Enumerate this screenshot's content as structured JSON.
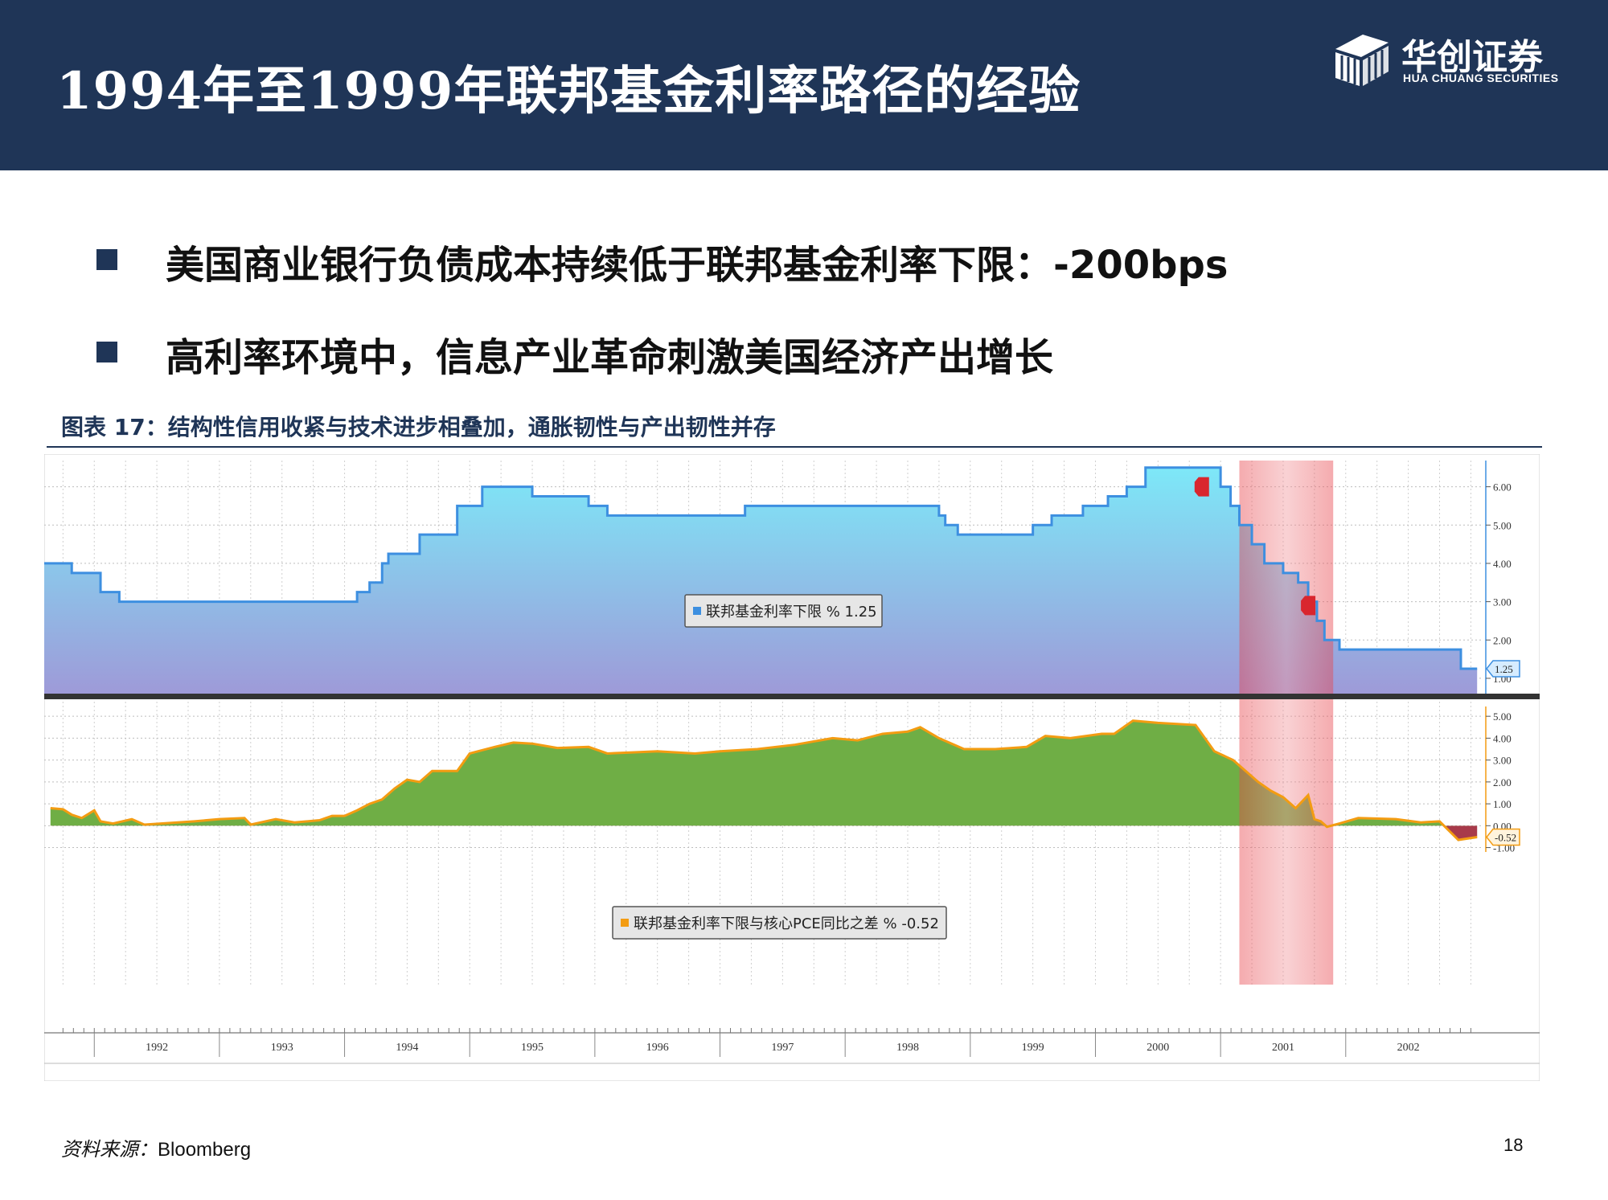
{
  "header": {
    "title": "1994年至1999年联邦基金利率路径的经验",
    "logo_cn": "华创证券",
    "logo_en": "HUA CHUANG SECURITIES",
    "bg_color": "#1f3557"
  },
  "bullets": [
    "美国商业银行负债成本持续低于联邦基金利率下限：-200bps",
    "高利率环境中，信息产业革命刺激美国经济产出增长"
  ],
  "figure": {
    "title": "图表 17：结构性信用收紧与技术进步相叠加，通胀韧性与产出韧性并存"
  },
  "source": {
    "label": "资料来源：",
    "value": "Bloomberg"
  },
  "page_number": "18",
  "chart_data": [
    {
      "type": "area",
      "series": [
        {
          "name": "联邦基金利率下限 % 1.25",
          "color": "#3d8fe0",
          "points": [
            [
              1991.6,
              4.0
            ],
            [
              1991.82,
              3.75
            ],
            [
              1992.05,
              3.25
            ],
            [
              1992.2,
              3.0
            ],
            [
              1993.0,
              3.0
            ],
            [
              1994.0,
              3.0
            ],
            [
              1994.1,
              3.25
            ],
            [
              1994.2,
              3.5
            ],
            [
              1994.3,
              4.0
            ],
            [
              1994.35,
              4.25
            ],
            [
              1994.6,
              4.75
            ],
            [
              1994.9,
              5.5
            ],
            [
              1995.1,
              6.0
            ],
            [
              1995.5,
              5.75
            ],
            [
              1995.95,
              5.5
            ],
            [
              1996.1,
              5.25
            ],
            [
              1997.2,
              5.5
            ],
            [
              1998.75,
              5.25
            ],
            [
              1998.8,
              5.0
            ],
            [
              1998.9,
              4.75
            ],
            [
              1999.5,
              5.0
            ],
            [
              1999.65,
              5.25
            ],
            [
              1999.9,
              5.5
            ],
            [
              2000.1,
              5.75
            ],
            [
              2000.25,
              6.0
            ],
            [
              2000.4,
              6.5
            ],
            [
              2001.0,
              6.0
            ],
            [
              2001.08,
              5.5
            ],
            [
              2001.15,
              5.0
            ],
            [
              2001.25,
              4.5
            ],
            [
              2001.35,
              4.0
            ],
            [
              2001.5,
              3.75
            ],
            [
              2001.62,
              3.5
            ],
            [
              2001.7,
              3.0
            ],
            [
              2001.77,
              2.5
            ],
            [
              2001.83,
              2.0
            ],
            [
              2001.95,
              1.75
            ],
            [
              2002.92,
              1.25
            ],
            [
              2003.05,
              1.25
            ]
          ]
        }
      ],
      "ylim": [
        0.6,
        6.6
      ],
      "yticks": [
        "1.00",
        "2.00",
        "3.00",
        "4.00",
        "5.00",
        "6.00"
      ],
      "last_value_label": "1.25",
      "event_markers": [
        {
          "x": 2000.85,
          "y": 6.0
        },
        {
          "x": 2001.7,
          "y": 2.9
        }
      ]
    },
    {
      "type": "area",
      "series": [
        {
          "name": "联邦基金利率下限与核心PCE同比之差 % -0.52",
          "color": "#f39c12",
          "points": [
            [
              1991.65,
              0.8
            ],
            [
              1991.75,
              0.75
            ],
            [
              1991.82,
              0.5
            ],
            [
              1991.9,
              0.35
            ],
            [
              1992.0,
              0.7
            ],
            [
              1992.05,
              0.2
            ],
            [
              1992.15,
              0.1
            ],
            [
              1992.3,
              0.3
            ],
            [
              1992.4,
              0.05
            ],
            [
              1992.8,
              0.2
            ],
            [
              1993.0,
              0.3
            ],
            [
              1993.2,
              0.35
            ],
            [
              1993.25,
              0.05
            ],
            [
              1993.45,
              0.3
            ],
            [
              1993.6,
              0.15
            ],
            [
              1993.8,
              0.25
            ],
            [
              1993.9,
              0.45
            ],
            [
              1994.0,
              0.45
            ],
            [
              1994.1,
              0.7
            ],
            [
              1994.2,
              1.0
            ],
            [
              1994.3,
              1.2
            ],
            [
              1994.4,
              1.7
            ],
            [
              1994.5,
              2.1
            ],
            [
              1994.6,
              2.0
            ],
            [
              1994.7,
              2.5
            ],
            [
              1994.9,
              2.5
            ],
            [
              1995.0,
              3.3
            ],
            [
              1995.2,
              3.6
            ],
            [
              1995.35,
              3.8
            ],
            [
              1995.5,
              3.75
            ],
            [
              1995.7,
              3.55
            ],
            [
              1995.95,
              3.6
            ],
            [
              1996.1,
              3.3
            ],
            [
              1996.3,
              3.35
            ],
            [
              1996.5,
              3.4
            ],
            [
              1996.8,
              3.3
            ],
            [
              1997.0,
              3.4
            ],
            [
              1997.3,
              3.5
            ],
            [
              1997.6,
              3.7
            ],
            [
              1997.9,
              4.0
            ],
            [
              1998.1,
              3.9
            ],
            [
              1998.3,
              4.2
            ],
            [
              1998.5,
              4.3
            ],
            [
              1998.6,
              4.5
            ],
            [
              1998.75,
              4.0
            ],
            [
              1998.95,
              3.5
            ],
            [
              1999.2,
              3.5
            ],
            [
              1999.45,
              3.6
            ],
            [
              1999.6,
              4.1
            ],
            [
              1999.8,
              4.0
            ],
            [
              2000.05,
              4.2
            ],
            [
              2000.15,
              4.2
            ],
            [
              2000.3,
              4.8
            ],
            [
              2000.5,
              4.7
            ],
            [
              2000.8,
              4.6
            ],
            [
              2000.95,
              3.4
            ],
            [
              2001.1,
              3.0
            ],
            [
              2001.2,
              2.5
            ],
            [
              2001.3,
              2.0
            ],
            [
              2001.4,
              1.6
            ],
            [
              2001.5,
              1.3
            ],
            [
              2001.6,
              0.8
            ],
            [
              2001.7,
              1.4
            ],
            [
              2001.75,
              0.3
            ],
            [
              2001.8,
              0.2
            ],
            [
              2001.85,
              -0.05
            ],
            [
              2001.95,
              0.1
            ],
            [
              2002.1,
              0.35
            ],
            [
              2002.4,
              0.3
            ],
            [
              2002.6,
              0.15
            ],
            [
              2002.75,
              0.2
            ],
            [
              2002.9,
              -0.65
            ],
            [
              2003.05,
              -0.52
            ]
          ]
        }
      ],
      "ylim": [
        -1.2,
        5.3
      ],
      "yticks": [
        "-1.00",
        "0.00",
        "1.00",
        "2.00",
        "3.00",
        "4.00",
        "5.00"
      ],
      "last_value_label": "-0.52"
    }
  ],
  "x_axis": {
    "years": [
      "1992",
      "1993",
      "1994",
      "1995",
      "1996",
      "1997",
      "1998",
      "1999",
      "2000",
      "2001",
      "2002"
    ]
  },
  "recession_shading": {
    "from": 2001.15,
    "to": 2001.9,
    "color": "#e8454c"
  }
}
